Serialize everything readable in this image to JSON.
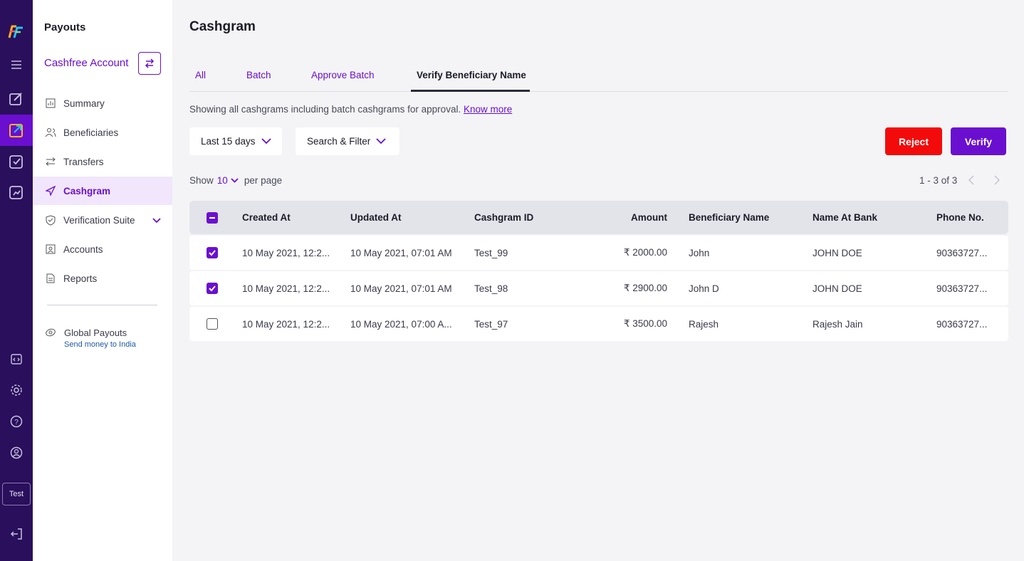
{
  "sidebar": {
    "title": "Payouts",
    "account": "Cashfree Account",
    "items": [
      {
        "label": "Summary"
      },
      {
        "label": "Beneficiaries"
      },
      {
        "label": "Transfers"
      },
      {
        "label": "Cashgram"
      },
      {
        "label": "Verification Suite"
      },
      {
        "label": "Accounts"
      },
      {
        "label": "Reports"
      }
    ],
    "global": {
      "title": "Global Payouts",
      "subtitle": "Send money to India"
    }
  },
  "rail": {
    "test_label": "Test"
  },
  "main": {
    "title": "Cashgram",
    "tabs": [
      {
        "label": "All"
      },
      {
        "label": "Batch"
      },
      {
        "label": "Approve Batch"
      },
      {
        "label": "Verify Beneficiary Name"
      }
    ],
    "info_text": "Showing all cashgrams including batch cashgrams for approval.",
    "info_link": "Know more",
    "date_filter": "Last 15 days",
    "search_filter": "Search & Filter",
    "reject_label": "Reject",
    "verify_label": "Verify",
    "show_label": "Show",
    "per_page_value": "10",
    "per_page_label": "per page",
    "pagination": "1 - 3 of 3"
  },
  "table": {
    "columns": [
      "Created At",
      "Updated At",
      "Cashgram ID",
      "Amount",
      "Beneficiary Name",
      "Name At Bank",
      "Phone No."
    ],
    "rows": [
      {
        "checked": true,
        "created": "10 May 2021, 12:2...",
        "updated": "10 May 2021, 07:01 AM",
        "id": "Test_99",
        "amount": "₹ 2000.00",
        "beneficiary": "John",
        "bank_name": "JOHN DOE",
        "phone": "90363727..."
      },
      {
        "checked": true,
        "created": "10 May 2021, 12:2...",
        "updated": "10 May 2021, 07:01 AM",
        "id": "Test_98",
        "amount": "₹ 2900.00",
        "beneficiary": "John D",
        "bank_name": "JOHN DOE",
        "phone": "90363727..."
      },
      {
        "checked": false,
        "created": "10 May 2021, 12:2...",
        "updated": "10 May 2021, 07:00 A...",
        "id": "Test_97",
        "amount": "₹ 3500.00",
        "beneficiary": "Rajesh",
        "bank_name": "Rajesh Jain",
        "phone": "90363727..."
      }
    ]
  },
  "colors": {
    "accent": "#6a0fd0",
    "rail": "#2a0f5c",
    "reject": "#f30b0b"
  }
}
